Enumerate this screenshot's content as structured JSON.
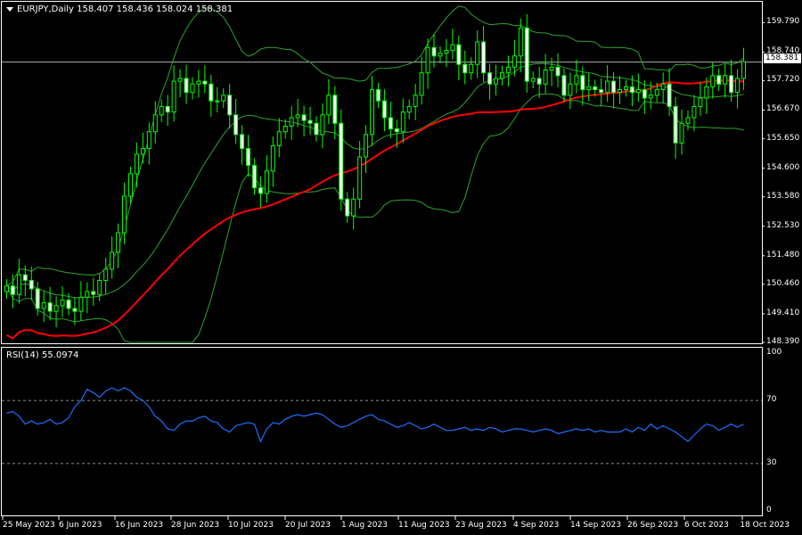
{
  "header": {
    "symbol_line": "EURJPY,Daily  158.407 158.436 158.024 158.381",
    "rsi_line": "RSI(14) 55.0974"
  },
  "current_price": "158.381",
  "colors": {
    "background": "#000000",
    "candle": "#00ff00",
    "bollinger": "#2ea32e",
    "ma": "#ff0000",
    "rsi": "#1e6fff",
    "frame": "#ffffff"
  },
  "chart_data": [
    {
      "type": "candlestick",
      "title": "EURJPY,Daily",
      "ylim": [
        148.39,
        160.5
      ],
      "y_ticks": [
        "159.790",
        "158.740",
        "157.720",
        "156.670",
        "155.650",
        "154.600",
        "153.580",
        "152.530",
        "151.480",
        "150.460",
        "149.410",
        "148.390"
      ],
      "x_ticks": [
        "25 May 2023",
        "6 Jun 2023",
        "16 Jun 2023",
        "28 Jun 2023",
        "10 Jul 2023",
        "20 Jul 2023",
        "1 Aug 2023",
        "11 Aug 2023",
        "23 Aug 2023",
        "4 Sep 2023",
        "14 Sep 2023",
        "26 Sep 2023",
        "6 Oct 2023",
        "18 Oct 2023"
      ],
      "close": [
        150.4,
        150.1,
        150.8,
        150.6,
        150.3,
        149.6,
        149.8,
        149.5,
        149.7,
        149.9,
        149.6,
        149.5,
        150.0,
        150.2,
        150.1,
        150.6,
        151.0,
        151.6,
        152.3,
        153.6,
        154.4,
        155.1,
        155.3,
        155.9,
        156.5,
        156.8,
        156.6,
        157.7,
        157.8,
        157.3,
        157.6,
        157.7,
        157.6,
        157.0,
        157.0,
        157.2,
        156.5,
        155.8,
        155.3,
        154.7,
        153.9,
        153.7,
        154.5,
        155.4,
        155.9,
        156.1,
        156.4,
        156.5,
        156.3,
        156.2,
        155.8,
        156.5,
        157.2,
        156.2,
        153.5,
        152.9,
        153.5,
        155.0,
        155.8,
        157.4,
        157.0,
        156.4,
        156.0,
        155.9,
        156.6,
        156.8,
        157.2,
        158.0,
        158.9,
        158.6,
        158.7,
        158.8,
        159.0,
        158.3,
        158.0,
        158.3,
        159.1,
        158.0,
        157.6,
        157.8,
        158.0,
        158.2,
        158.6,
        159.6,
        157.7,
        157.8,
        157.6,
        158.1,
        158.2,
        157.9,
        157.2,
        157.6,
        157.9,
        157.4,
        157.5,
        157.4,
        157.3,
        157.7,
        157.3,
        157.4,
        157.5,
        157.3,
        157.4,
        157.1,
        157.2,
        157.4,
        157.6,
        156.8,
        155.5,
        156.2,
        156.4,
        156.8,
        157.1,
        157.5,
        157.9,
        157.6,
        157.9,
        157.3,
        157.8,
        158.4
      ],
      "series": [
        {
          "name": "MA",
          "type": "line"
        },
        {
          "name": "Bollinger Bands",
          "type": "band"
        }
      ]
    },
    {
      "type": "line",
      "title": "RSI(14) 55.0974",
      "ylim": [
        0,
        100
      ],
      "y_ticks": [
        "100",
        "70",
        "30",
        "0"
      ],
      "levels": [
        70,
        30
      ],
      "values": [
        62,
        63,
        60,
        55,
        57,
        55,
        56,
        58,
        55,
        56,
        59,
        66,
        70,
        77,
        75,
        72,
        76,
        78,
        76,
        78,
        76,
        72,
        70,
        66,
        60,
        57,
        52,
        51,
        55,
        57,
        57,
        59,
        60,
        57,
        56,
        52,
        50,
        54,
        55,
        56,
        55,
        44,
        52,
        56,
        55,
        58,
        60,
        61,
        60,
        61,
        62,
        61,
        58,
        55,
        53,
        54,
        56,
        58,
        60,
        61,
        58,
        57,
        55,
        53,
        54,
        56,
        54,
        52,
        53,
        55,
        53,
        51,
        51,
        52,
        53,
        51,
        52,
        51,
        53,
        52,
        50,
        51,
        52,
        52,
        51,
        50,
        51,
        52,
        51,
        49,
        50,
        51,
        52,
        51,
        52,
        50,
        51,
        50,
        50,
        50,
        52,
        50,
        53,
        51,
        55,
        52,
        54,
        52,
        50,
        47,
        44,
        48,
        52,
        55,
        54,
        51,
        53,
        55,
        53,
        55
      ]
    }
  ]
}
